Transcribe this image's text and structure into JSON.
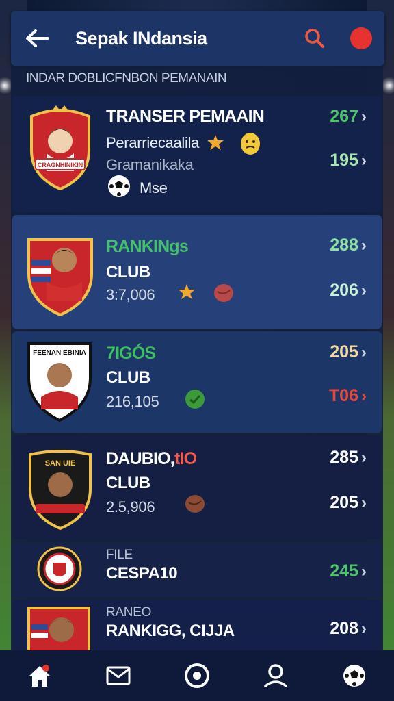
{
  "header": {
    "title": "Sepak INdansia"
  },
  "section_title": "INDAR DOBLICFNBON PEMANAIN",
  "cards": [
    {
      "title": "TRANSER PEMAAIN",
      "line2": "Perarriecaalila",
      "line3": "Gramanikaka",
      "line4": "Mse",
      "stat_top": "267",
      "stat_bottom": "195",
      "badge_text": "CRAGNHINIKIN",
      "colors": {
        "stat_top": "#4cc46a",
        "stat_bottom": "#a8e6b4"
      }
    },
    {
      "title": "RANKINgs",
      "line2": "CLUB",
      "line3": "3:7,006",
      "stat_top": "288",
      "stat_bottom": "206",
      "colors": {
        "title": "#45c06a",
        "stat_top": "#8ee3a0",
        "stat_bottom": "#c8f0d2"
      }
    },
    {
      "title": "7IGÓS",
      "line2": "CLUB",
      "line3": "216,105",
      "stat_top": "205",
      "stat_bottom": "T06",
      "badge_text": "FEENAN EBINIA",
      "colors": {
        "title": "#3fbf5e",
        "stat_top": "#f3d9a0",
        "stat_bottom": "#e2483e"
      }
    },
    {
      "title_a": "DAUBIO,",
      "title_b": "tIO",
      "line2": "CLUB",
      "line3": "2.5,906",
      "stat_top": "285",
      "stat_bottom": "205",
      "badge_text": "SAN UIE",
      "colors": {
        "title_b": "#ef5a52",
        "stat_top": "#ffffff",
        "stat_bottom": "#ffffff"
      }
    },
    {
      "title": "FILE",
      "line2": "CESPA10",
      "stat_top": "245",
      "colors": {
        "stat_top": "#4cc46a"
      }
    },
    {
      "title": "RANEO",
      "line2": "RANKIGG, CIJJA",
      "stat_top": "208",
      "colors": {
        "stat_top": "#ffffff"
      }
    }
  ],
  "nav": [
    "home-icon",
    "mail-icon",
    "target-icon",
    "profile-icon",
    "ball-icon"
  ],
  "theme": {
    "accent": "#1d3566",
    "red": "#e8322f",
    "green": "#4cc46a"
  }
}
